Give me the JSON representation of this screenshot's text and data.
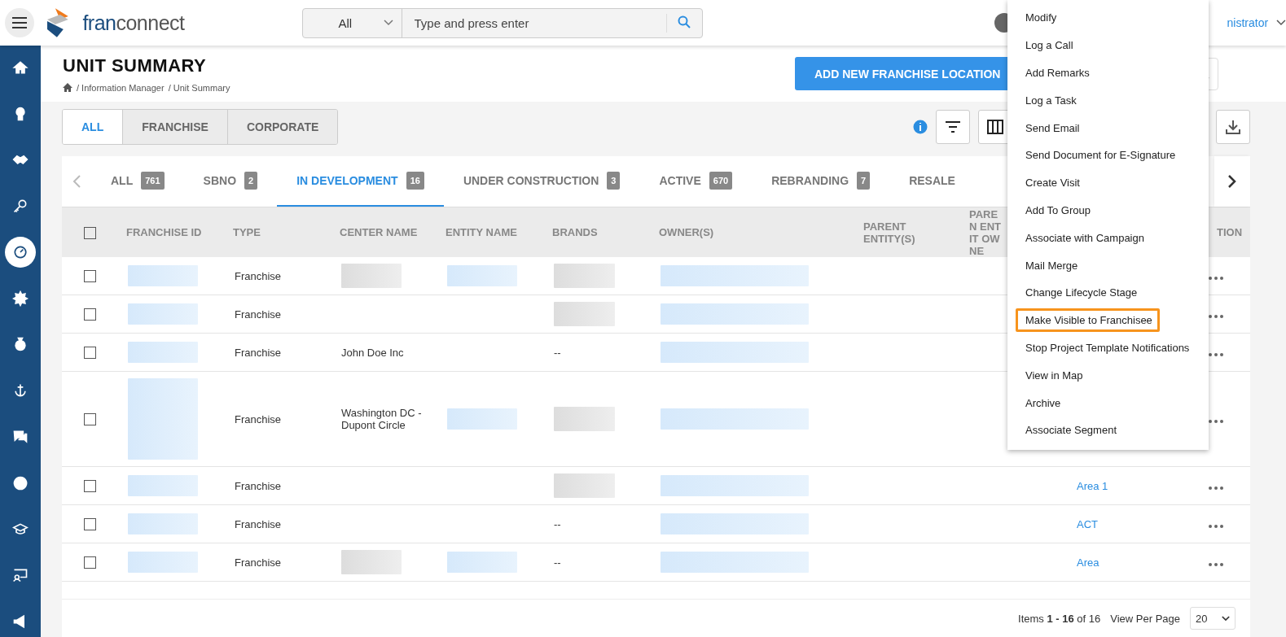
{
  "header": {
    "logo_text": [
      "fran",
      "connect"
    ],
    "search": {
      "scope": "All",
      "placeholder": "Type and press enter"
    },
    "user": "nistrator"
  },
  "sidebar": {
    "items": [
      {
        "selected": false
      },
      {
        "selected": false
      },
      {
        "selected": false
      },
      {
        "selected": false
      },
      {
        "selected": true
      },
      {
        "selected": false
      },
      {
        "selected": false
      },
      {
        "selected": false
      },
      {
        "selected": false
      },
      {
        "selected": false
      },
      {
        "selected": false
      },
      {
        "selected": false
      },
      {
        "selected": false
      }
    ]
  },
  "page": {
    "title": "UNIT SUMMARY",
    "breadcrumb": [
      "/ Information Manager",
      "/ Unit Summary"
    ],
    "add_button": "ADD NEW FRANCHISE LOCATION"
  },
  "segments": [
    {
      "label": "ALL",
      "selected": true
    },
    {
      "label": "FRANCHISE",
      "selected": false
    },
    {
      "label": "CORPORATE",
      "selected": false
    }
  ],
  "status_tabs": [
    {
      "label": "ALL",
      "count": "761",
      "selected": false
    },
    {
      "label": "SBNO",
      "count": "2",
      "selected": false
    },
    {
      "label": "IN DEVELOPMENT",
      "count": "16",
      "selected": true
    },
    {
      "label": "UNDER CONSTRUCTION",
      "count": "3",
      "selected": false
    },
    {
      "label": "ACTIVE",
      "count": "670",
      "selected": false
    },
    {
      "label": "REBRANDING",
      "count": "7",
      "selected": false
    },
    {
      "label": "RESALE",
      "selected": false
    }
  ],
  "table": {
    "header_checkbox": {
      "checked": false
    },
    "columns": [
      "FRANCHISE ID",
      "TYPE",
      "CENTER NAME",
      "ENTITY NAME",
      "BRANDS",
      "OWNER(S)",
      "PARENT ENTITY(S)",
      "PAREN ENTIT OWNE",
      "",
      "TION"
    ],
    "rows": [
      {
        "checked": false,
        "tall": false,
        "cells": [
          {
            "kind": "blurred-link"
          },
          {
            "kind": "text",
            "text": "Franchise"
          },
          {
            "kind": "blurred-text"
          },
          {
            "kind": "blurred-link"
          },
          {
            "kind": "blurred-text"
          },
          {
            "kind": "blurred-link"
          },
          null,
          null,
          null,
          {
            "kind": "more"
          }
        ]
      },
      {
        "checked": false,
        "tall": false,
        "cells": [
          {
            "kind": "blurred-link"
          },
          {
            "kind": "text",
            "text": "Franchise"
          },
          null,
          null,
          {
            "kind": "blurred-text"
          },
          {
            "kind": "blurred-link"
          },
          null,
          null,
          null,
          {
            "kind": "more"
          }
        ]
      },
      {
        "checked": false,
        "tall": false,
        "cells": [
          {
            "kind": "blurred-link"
          },
          {
            "kind": "text",
            "text": "Franchise"
          },
          {
            "kind": "text",
            "text": "John Doe Inc"
          },
          null,
          {
            "kind": "text",
            "text": "--"
          },
          {
            "kind": "blurred-link"
          },
          null,
          null,
          null,
          {
            "kind": "more"
          }
        ]
      },
      {
        "checked": false,
        "tall": true,
        "cells": [
          {
            "kind": "blurred-link"
          },
          {
            "kind": "text",
            "text": "Franchise"
          },
          {
            "kind": "text",
            "text": "Washington DC - Dupont Circle"
          },
          {
            "kind": "blurred-link"
          },
          {
            "kind": "blurred-text"
          },
          {
            "kind": "blurred-link"
          },
          null,
          null,
          null,
          {
            "kind": "more"
          }
        ]
      },
      {
        "checked": false,
        "tall": false,
        "cells": [
          {
            "kind": "blurred-link"
          },
          {
            "kind": "text",
            "text": "Franchise"
          },
          null,
          null,
          {
            "kind": "blurred-text"
          },
          {
            "kind": "blurred-link"
          },
          null,
          null,
          {
            "kind": "link",
            "text": "Area 1"
          },
          {
            "kind": "more"
          }
        ]
      },
      {
        "checked": false,
        "tall": false,
        "cells": [
          {
            "kind": "blurred-link"
          },
          {
            "kind": "text",
            "text": "Franchise"
          },
          null,
          null,
          {
            "kind": "text",
            "text": "--"
          },
          {
            "kind": "blurred-link"
          },
          null,
          null,
          {
            "kind": "link",
            "text": "ACT"
          },
          {
            "kind": "more"
          }
        ]
      },
      {
        "checked": false,
        "tall": false,
        "cells": [
          {
            "kind": "blurred-link"
          },
          {
            "kind": "text",
            "text": "Franchise"
          },
          {
            "kind": "blurred-text"
          },
          {
            "kind": "blurred-link"
          },
          {
            "kind": "text",
            "text": "--"
          },
          {
            "kind": "blurred-link"
          },
          null,
          null,
          {
            "kind": "link",
            "text": "Area"
          },
          {
            "kind": "more"
          }
        ]
      }
    ]
  },
  "pagination": {
    "summary": "Items **1 - 16** of 16",
    "per_page_label": "View Per Page",
    "per_page": "20"
  },
  "action_menu": {
    "items": [
      {
        "label": "Modify",
        "selected": false
      },
      {
        "label": "Log a Call",
        "selected": false
      },
      {
        "label": "Add Remarks",
        "selected": false
      },
      {
        "label": "Log a Task",
        "selected": false
      },
      {
        "label": "Send Email",
        "selected": false
      },
      {
        "label": "Send Document for E-Signature",
        "selected": false
      },
      {
        "label": "Create Visit",
        "selected": false
      },
      {
        "label": "Add To Group",
        "selected": false
      },
      {
        "label": "Associate with Campaign",
        "selected": false
      },
      {
        "label": "Mail Merge",
        "selected": false
      },
      {
        "label": "Change Lifecycle Stage",
        "selected": false
      },
      {
        "label": "Make Visible to Franchisee",
        "selected": true
      },
      {
        "label": "Stop Project Template Notifications",
        "selected": false
      },
      {
        "label": "View in Map",
        "selected": false
      },
      {
        "label": "Archive",
        "selected": false
      },
      {
        "label": "Associate Segment",
        "selected": false
      }
    ]
  }
}
